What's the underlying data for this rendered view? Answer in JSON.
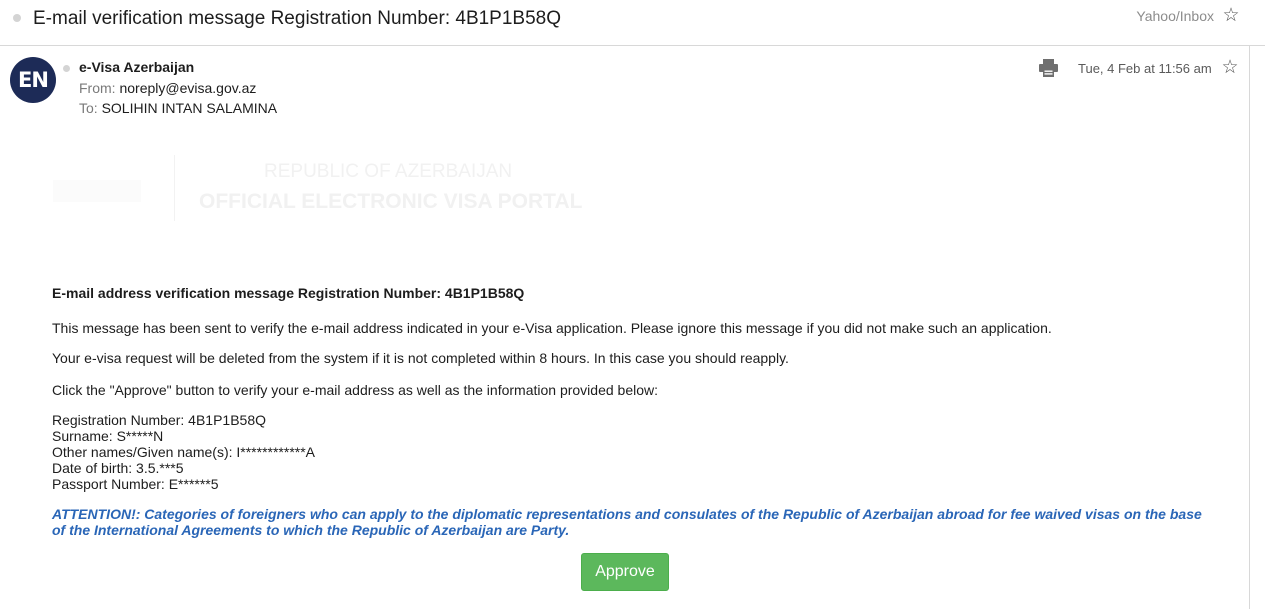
{
  "message": {
    "subject": "E-mail verification message Registration Number: 4B1P1B58Q",
    "folder": "Yahoo/Inbox",
    "sender": {
      "avatar_initials": "EN",
      "name": "e-Visa Azerbaijan",
      "from_label": "From:",
      "from_email": "noreply@evisa.gov.az",
      "to_label": "To:",
      "to_name": "SOLIHIN INTAN SALAMINA"
    },
    "date": "Tue, 4 Feb at 11:56 am",
    "icons": {
      "subject_star": "star-outline-icon",
      "print": "printer-icon",
      "message_star": "star-outline-icon"
    }
  },
  "banner": {
    "line1": "REPUBLIC OF AZERBAIJAN",
    "line2": "OFFICIAL ELECTRONIC VISA PORTAL"
  },
  "body": {
    "heading": "E-mail address verification message Registration Number: 4B1P1B58Q",
    "p1": "This message has been sent to verify the e-mail address indicated in your e-Visa application. Please ignore this message if you did not make such an application.",
    "p2": "Your e-visa request will be deleted from the system if it is not completed within 8 hours. In this case you should reapply.",
    "p3": "Click the \"Approve\" button to verify your e-mail address as well as the information provided below:",
    "details": [
      "Registration Number: 4B1P1B58Q",
      "Surname: S*****N",
      "Other names/Given name(s): I************A",
      "Date of birth: 3.5.***5",
      "Passport Number: E******5"
    ],
    "attention": "ATTENTION!: Categories of foreigners who can apply to the diplomatic representations and consulates of the Republic of Azerbaijan abroad for fee waived visas on the base of the International Agreements to which the Republic of Azerbaijan are Party.",
    "approve_label": "Approve"
  },
  "colors": {
    "avatar_bg": "#1d2b57",
    "attention_text": "#2a66b7",
    "approve_bg": "#5cb85c"
  }
}
